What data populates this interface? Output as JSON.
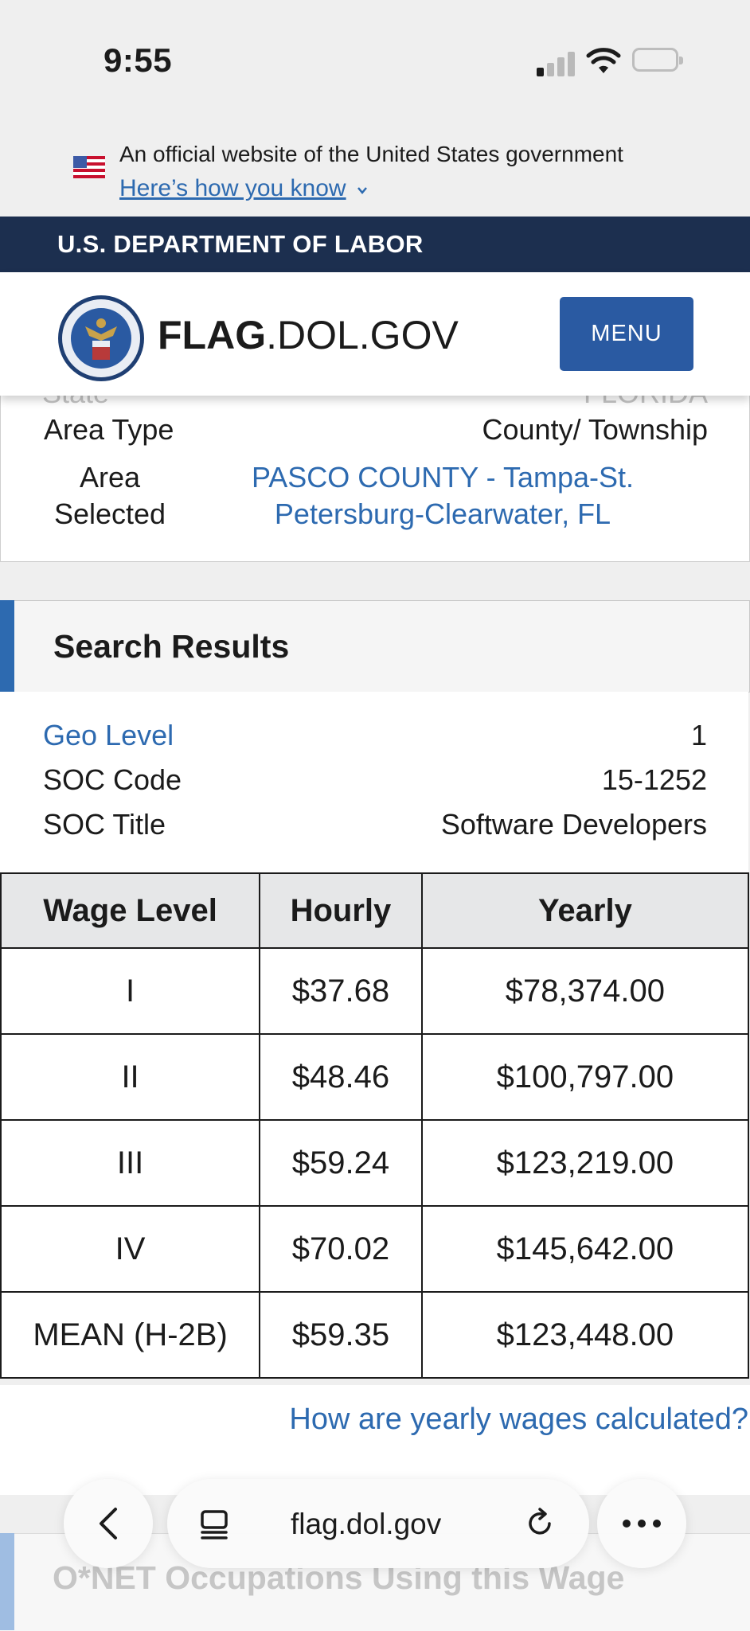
{
  "status_bar": {
    "time": "9:55"
  },
  "gov_banner": {
    "official_text": "An official website of the United States government",
    "how_link": "Here’s how you know"
  },
  "dept_bar": {
    "label": "U.S. DEPARTMENT OF LABOR"
  },
  "site_header": {
    "logo_bold": "FLAG",
    "logo_rest": ".DOL.GOV",
    "menu_label": "MENU"
  },
  "search_details": {
    "partial_label": "State",
    "partial_value": "FLORIDA",
    "area_type_label": "Area Type",
    "area_type_value": "County/ Township",
    "area_selected_label": "Area Selected",
    "area_selected_value": "PASCO COUNTY - Tampa-St. Petersburg-Clearwater, FL"
  },
  "results": {
    "title": "Search Results",
    "info": [
      {
        "label": "Geo Level",
        "value": "1"
      },
      {
        "label": "SOC Code",
        "value": "15-1252"
      },
      {
        "label": "SOC Title",
        "value": "Software Developers"
      }
    ],
    "table": {
      "headers": [
        "Wage Level",
        "Hourly",
        "Yearly"
      ],
      "rows": [
        [
          "I",
          "$37.68",
          "$78,374.00"
        ],
        [
          "II",
          "$48.46",
          "$100,797.00"
        ],
        [
          "III",
          "$59.24",
          "$123,219.00"
        ],
        [
          "IV",
          "$70.02",
          "$145,642.00"
        ],
        [
          "MEAN (H-2B)",
          "$59.35",
          "$123,448.00"
        ]
      ]
    },
    "calc_link": "How are yearly wages calculated?"
  },
  "onet": {
    "title": "O*NET Occupations Using this Wage"
  },
  "browser": {
    "url": "flag.dol.gov"
  }
}
